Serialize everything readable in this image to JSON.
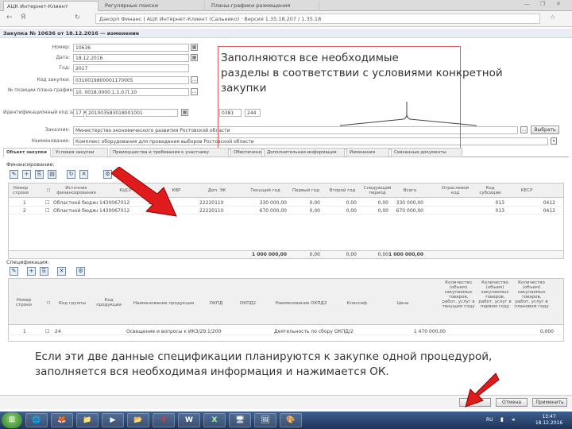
{
  "browser": {
    "tabs": [
      "АЦК Интернет-Клиент",
      "Регулярные поиски",
      "Планы-графики размещения"
    ],
    "back_glyph": "←",
    "forward_glyph": "Я",
    "address": "Дакорп Финанс | АЦК Интернет-Клиент (Сальнико) · Версия 1.35.18.207 / 1.35.18",
    "window_controls": [
      "—",
      "❐",
      "✕"
    ]
  },
  "document": {
    "title": "Закупка № 10636 от 18.12.2016 — изменение"
  },
  "form": {
    "number_label": "Номер:",
    "number_value": "10636",
    "date_label": "Дата:",
    "date_value": "18.12.2016",
    "year_label": "Год:",
    "year_value": "2017",
    "customer_code_label": "Код закупки:",
    "customer_code_value": "0310019800001170005",
    "plan_position_label": "№ позиции плана-графика:",
    "plan_position_value": "10. 0018.0000.1.1.0.П.10",
    "ikz_label": "Идентификационный код закупки:",
    "ikz_parts": [
      "17",
      "201003583018001001",
      "0381",
      "244"
    ],
    "customer_label": "Заказчик:",
    "customer_value": "Министерство экономического развития Ростовской области",
    "name_label": "Наименование:",
    "name_value": "Комплекс оборудования для проведения выборов Ростовской области",
    "select_button": "Выбрать"
  },
  "notes": {
    "top": [
      "Заполняются все необходимые",
      "разделы в соответствии с условиями конкретной",
      "закупки"
    ],
    "bottom": [
      "Если эти две данные спецификации планируются к закупке одной процедурой,",
      "заполняется вся необходимая информация и нажимается ОК."
    ]
  },
  "section_tabs": [
    "Объект закупки",
    "Условия закупки",
    "Преимущества и требования к участнику",
    "Обеспечение",
    "Дополнительная информация",
    "Изменения",
    "Связанные документы"
  ],
  "finance": {
    "section_title": "Финансирование:",
    "columns": [
      "Номер строки",
      "",
      "Источник финансирования",
      "КЦСР",
      "КВР",
      "Доп. ЭК",
      "Текущий год",
      "Первый год",
      "Второй год",
      "Следующий период",
      "Всего",
      "Отраслевой код",
      "Код субсидии",
      "КЕСР"
    ],
    "rows": [
      [
        "1",
        "Областной бюджет",
        "1430067012",
        "244",
        "22220110",
        "330 000,00",
        "0,00",
        "0,00",
        "0,00",
        "330 000,00",
        "",
        "013",
        "0412"
      ],
      [
        "2",
        "Областной бюджет",
        "1430067012",
        "244",
        "22220110",
        "670 000,00",
        "0,00",
        "0,00",
        "0,00",
        "670 000,00",
        "",
        "013",
        "0412"
      ]
    ],
    "totals": [
      "1 000 000,00",
      "0,00",
      "0,00",
      "0,00",
      "1 000 000,00"
    ]
  },
  "spec": {
    "section_title": "Спецификация:",
    "columns": [
      "Номер строки",
      "",
      "Код группы",
      "Код продукции",
      "Наименование продукции",
      "ОКПД",
      "ОКПД2",
      "Наименование ОКПД2",
      "Классиф.",
      "Цена",
      "Количество (объем) закупаемых товаров, работ, услуг в текущем году",
      "Количество (объем) закупаемых товаров, работ, услуг в первом году",
      "Количество (объем) закупаемых товаров, работ, услуг в плановом году"
    ],
    "rows": [
      [
        "1",
        "24",
        "",
        "Освещение и вопросы к ИКЗ/29.1/20000",
        "",
        "",
        "Деятельность по сбору ОКПД/29.7",
        "",
        "",
        "1 470 000,00",
        "",
        "0,000",
        ""
      ]
    ]
  },
  "footer_buttons": [
    "ОК",
    "Отмена",
    "Применить"
  ],
  "taskbar": {
    "start_glyph": "⊞",
    "items": [
      "🌐",
      "🦊",
      "📁",
      "▶",
      "📂",
      "Y",
      "W",
      "X",
      "🖥",
      "🖼",
      "🎨"
    ],
    "lang": "RU",
    "time": "13:47",
    "date": "18.12.2016"
  }
}
